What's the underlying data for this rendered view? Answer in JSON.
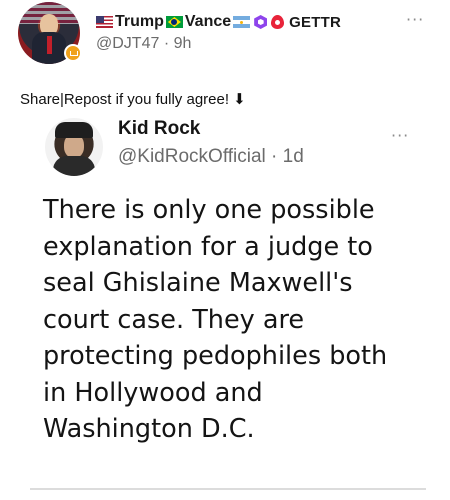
{
  "post": {
    "display_name": "Trump",
    "display_name_2": "Vance",
    "gettr_label": "GETTR",
    "handle": "@DJT47",
    "separator": "·",
    "time": "9h",
    "more_label": "···",
    "share_text": "Share|Repost if you fully agree! ⬇"
  },
  "quote": {
    "name": "Kid Rock",
    "handle": "@KidRockOfficial",
    "separator": "·",
    "time": "1d",
    "more_label": "···",
    "body_lines": [
      "There is only one possible",
      "explanation for a judge to",
      "seal Ghislaine Maxwell's",
      "court case. They are",
      "protecting pedophiles both",
      "in Hollywood and",
      "Washington D.C."
    ]
  },
  "icons": {
    "flag_1": "us-flag-icon",
    "flag_2": "brazil-flag-icon",
    "flag_3": "argentina-flag-icon",
    "badge_1": "purple-hexagon-icon",
    "badge_2": "gettr-logo-icon",
    "verified": "gold-verified-badge-icon"
  },
  "colors": {
    "handle_gray": "#6b6b6b",
    "text_black": "#111111",
    "gettr_red": "#e8233a",
    "hex_purple": "#8e44ec",
    "badge_gold": "#f0a21c"
  }
}
